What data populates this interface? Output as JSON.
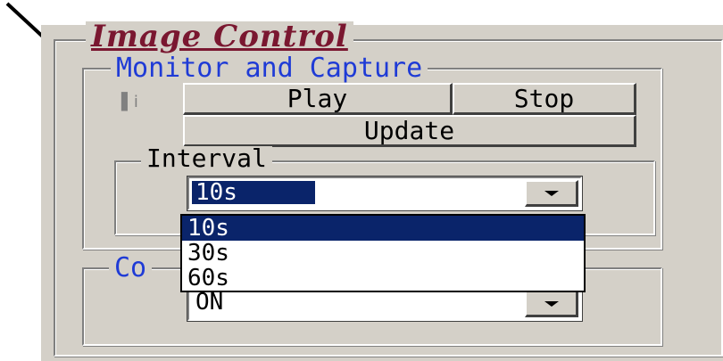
{
  "frame": {
    "title": "Image Control"
  },
  "monitor_group": {
    "title": "Monitor and Capture",
    "indicator": "▌i",
    "buttons": {
      "play": "Play",
      "stop": "Stop",
      "update": "Update"
    }
  },
  "interval_group": {
    "title": "Interval",
    "selected": "10s",
    "options": [
      "10s",
      "30s",
      "60s"
    ],
    "highlighted_option": "10s"
  },
  "second_group": {
    "title_visible": "Co",
    "combo_value": "ON"
  },
  "colors": {
    "selection": "#0a246a",
    "group_title": "#1f3bd6",
    "frame_title": "#7a1730",
    "face": "#d4d0c8"
  }
}
